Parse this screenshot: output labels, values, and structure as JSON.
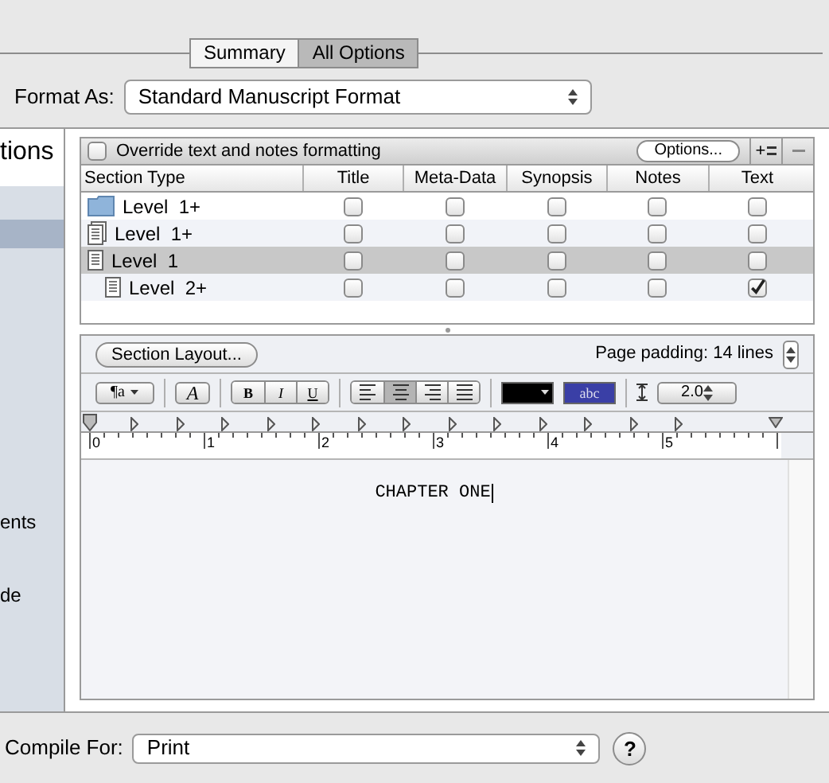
{
  "view_tabs": [
    {
      "label": "Summary",
      "selected": false
    },
    {
      "label": "All Options",
      "selected": true
    }
  ],
  "format_as": {
    "label": "Format As:",
    "value": "Standard Manuscript Format"
  },
  "sidebar": {
    "heading": "tions",
    "items": [
      {
        "selected": true
      },
      {
        "label": "ents",
        "selected": false
      },
      {
        "label": "de",
        "selected": false
      }
    ]
  },
  "section_table": {
    "override": {
      "label": "Override text and notes formatting",
      "checked": false
    },
    "options_button": "Options...",
    "add_glyph": "+",
    "columns": [
      "Section Type",
      "Title",
      "Meta-Data",
      "Synopsis",
      "Notes",
      "Text"
    ],
    "rows": [
      {
        "kind": "folder",
        "label": "Level  1+",
        "selected": false,
        "checks": [
          false,
          false,
          false,
          false,
          false
        ]
      },
      {
        "kind": "stack",
        "label": "Level  1+",
        "selected": false,
        "checks": [
          false,
          false,
          false,
          false,
          false
        ]
      },
      {
        "kind": "document",
        "label": "Level  1",
        "selected": true,
        "checks": [
          false,
          false,
          false,
          false,
          false
        ],
        "children": [
          {
            "kind": "document",
            "label": "Level  2+",
            "selected": false,
            "checks": [
              false,
              false,
              false,
              false,
              true
            ]
          }
        ]
      }
    ]
  },
  "layout": {
    "section_layout_button": "Section Layout...",
    "page_padding": "Page padding: 14 lines",
    "style_button": "¶a",
    "font_button": "A",
    "format_buttons": [
      "B",
      "I",
      "U"
    ],
    "alignments": [
      {
        "selected": false
      },
      {
        "selected": true
      },
      {
        "selected": false
      },
      {
        "selected": false
      }
    ],
    "text_color": {
      "color": "#000000"
    },
    "highlight": {
      "label": "abc",
      "color": "#3a3fa6"
    },
    "line_spacing": "2.0",
    "ruler_labels": [
      "0",
      "1",
      "2",
      "3",
      "4",
      "5"
    ],
    "document_text": "CHAPTER ONE"
  },
  "compile_for": {
    "label": "Compile For:",
    "value": "Print"
  },
  "help": "?"
}
